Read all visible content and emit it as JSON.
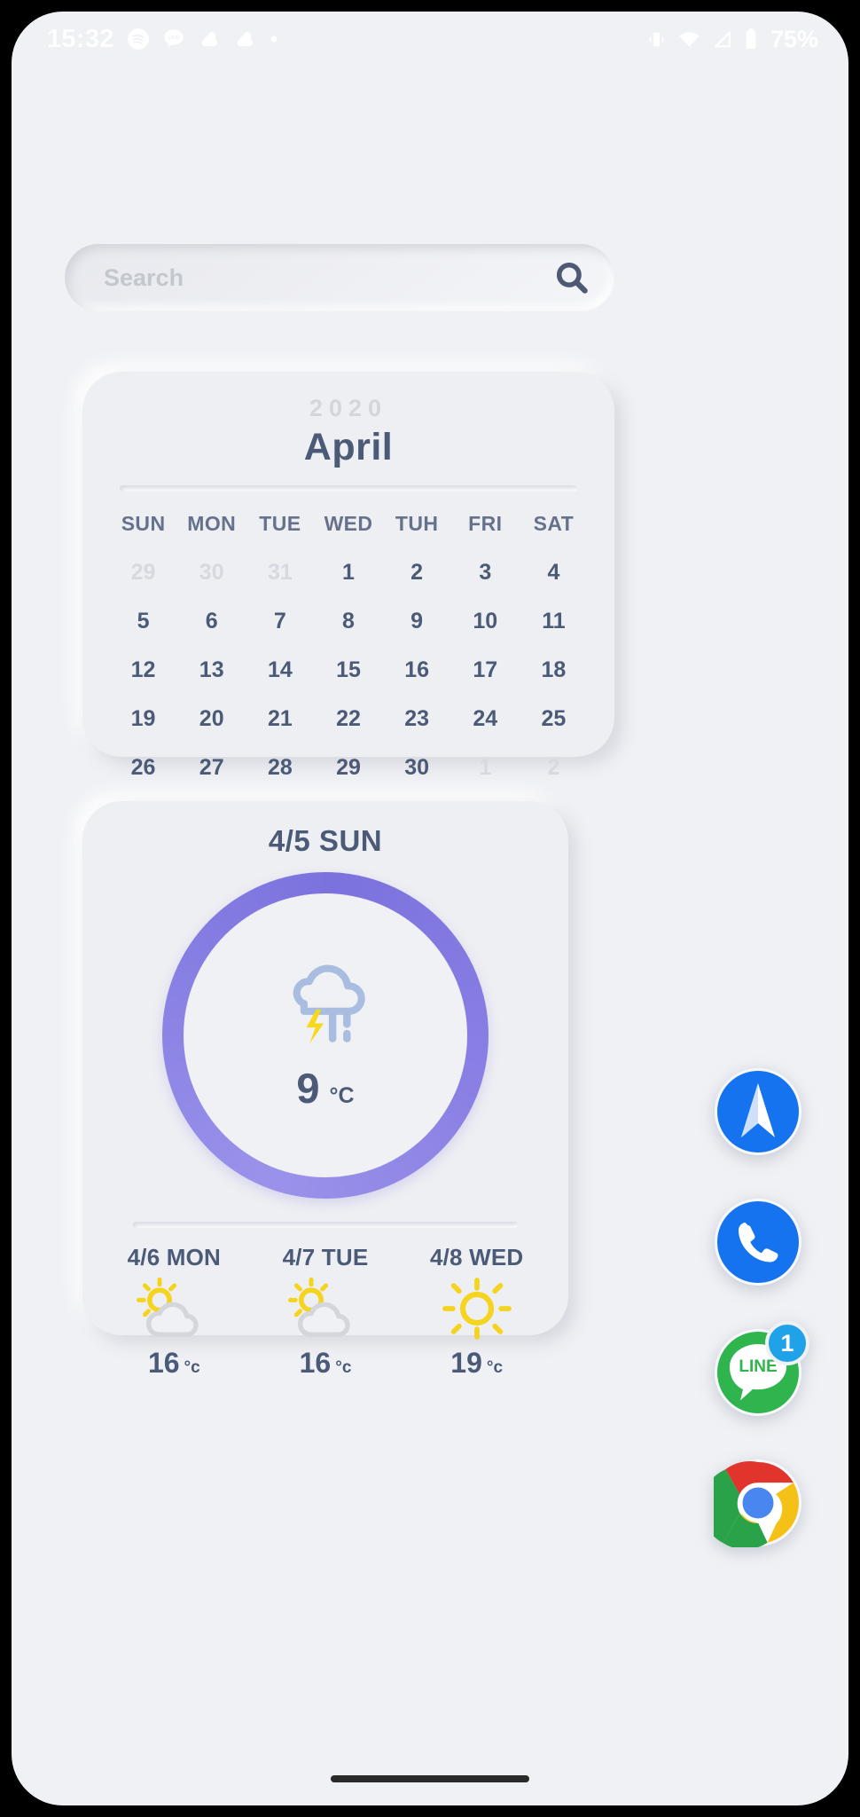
{
  "status_bar": {
    "clock": "15:32",
    "battery_label": "75%",
    "notification_icons": [
      "spotify-icon",
      "line-icon",
      "weather-cloud-icon",
      "weather-cloud-icon",
      "dot-icon"
    ],
    "system_icons": [
      "vibrate-icon",
      "wifi-icon",
      "signal-icon",
      "battery-icon"
    ]
  },
  "search": {
    "placeholder": "Search",
    "value": "",
    "icon": "search-icon"
  },
  "calendar": {
    "year": "2020",
    "month": "April",
    "weekdays": [
      "SUN",
      "MON",
      "TUE",
      "WED",
      "TUH",
      "FRI",
      "SAT"
    ],
    "weeks": [
      [
        {
          "d": "29",
          "muted": true
        },
        {
          "d": "30",
          "muted": true
        },
        {
          "d": "31",
          "muted": true
        },
        {
          "d": "1",
          "muted": false
        },
        {
          "d": "2",
          "muted": false
        },
        {
          "d": "3",
          "muted": false
        },
        {
          "d": "4",
          "muted": false
        }
      ],
      [
        {
          "d": "5",
          "muted": false
        },
        {
          "d": "6",
          "muted": false
        },
        {
          "d": "7",
          "muted": false
        },
        {
          "d": "8",
          "muted": false
        },
        {
          "d": "9",
          "muted": false
        },
        {
          "d": "10",
          "muted": false
        },
        {
          "d": "11",
          "muted": false
        }
      ],
      [
        {
          "d": "12",
          "muted": false
        },
        {
          "d": "13",
          "muted": false
        },
        {
          "d": "14",
          "muted": false
        },
        {
          "d": "15",
          "muted": false
        },
        {
          "d": "16",
          "muted": false
        },
        {
          "d": "17",
          "muted": false
        },
        {
          "d": "18",
          "muted": false
        }
      ],
      [
        {
          "d": "19",
          "muted": false
        },
        {
          "d": "20",
          "muted": false
        },
        {
          "d": "21",
          "muted": false
        },
        {
          "d": "22",
          "muted": false
        },
        {
          "d": "23",
          "muted": false
        },
        {
          "d": "24",
          "muted": false
        },
        {
          "d": "25",
          "muted": false
        }
      ],
      [
        {
          "d": "26",
          "muted": false
        },
        {
          "d": "27",
          "muted": false
        },
        {
          "d": "28",
          "muted": false
        },
        {
          "d": "29",
          "muted": false
        },
        {
          "d": "30",
          "muted": false
        },
        {
          "d": "1",
          "muted": true
        },
        {
          "d": "2",
          "muted": true
        }
      ]
    ]
  },
  "weather": {
    "title": "4/5 SUN",
    "current": {
      "temp": "9",
      "unit": "°C",
      "condition_icon": "thunderstorm-icon",
      "ring_color": "#7b72de"
    },
    "forecast": [
      {
        "day": "4/6 MON",
        "icon": "partly-cloudy-icon",
        "temp": "16",
        "unit": "°c"
      },
      {
        "day": "4/7 TUE",
        "icon": "partly-cloudy-icon",
        "temp": "16",
        "unit": "°c"
      },
      {
        "day": "4/8 WED",
        "icon": "sunny-icon",
        "temp": "19",
        "unit": "°c"
      }
    ]
  },
  "dock": {
    "apps": [
      {
        "name": "spark-mail",
        "icon": "paper-plane-icon",
        "badge": ""
      },
      {
        "name": "phone",
        "icon": "phone-handset-icon",
        "badge": ""
      },
      {
        "name": "line",
        "icon": "line-chat-icon",
        "badge": "1"
      },
      {
        "name": "chrome",
        "icon": "chrome-icon",
        "badge": ""
      }
    ]
  },
  "colors": {
    "background": "#f0f1f5",
    "card": "#eeeff3",
    "text_primary": "#4a5a77",
    "text_muted": "#d6d9e0",
    "accent_purple": "#7b72de",
    "accent_yellow": "#f5d41f",
    "badge_blue": "#1fa2e8"
  }
}
